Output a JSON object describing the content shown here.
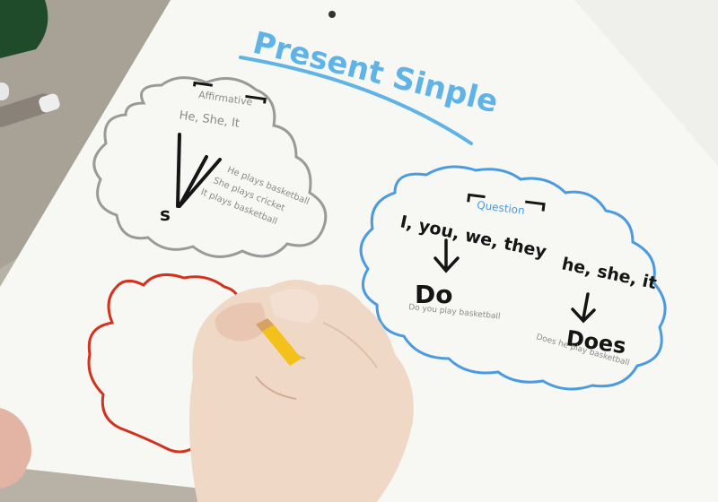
{
  "title": "Present Sinple",
  "affirmative": {
    "label": "Affirmative",
    "subject": "He, She, It",
    "ending": "s",
    "examples": [
      "He plays basketball",
      "She plays cricket",
      "It plays basketball"
    ]
  },
  "question": {
    "label": "Question",
    "subjects_plural": "I, you, we, they",
    "aux_plural": "Do",
    "example_plural": "Do you play basketball",
    "subjects_singular": "he, she, it",
    "aux_singular": "Does",
    "example_singular": "Does he play basketball"
  },
  "colors": {
    "title": "#5fb3e6",
    "gray_cloud": "#9a9a9a",
    "blue_cloud": "#4a9be0",
    "red_cloud": "#d2321e",
    "ink": "#151515",
    "paper": "#f7f7f4",
    "pencil": "#f2c21a",
    "skin": "#f0d8c6"
  }
}
